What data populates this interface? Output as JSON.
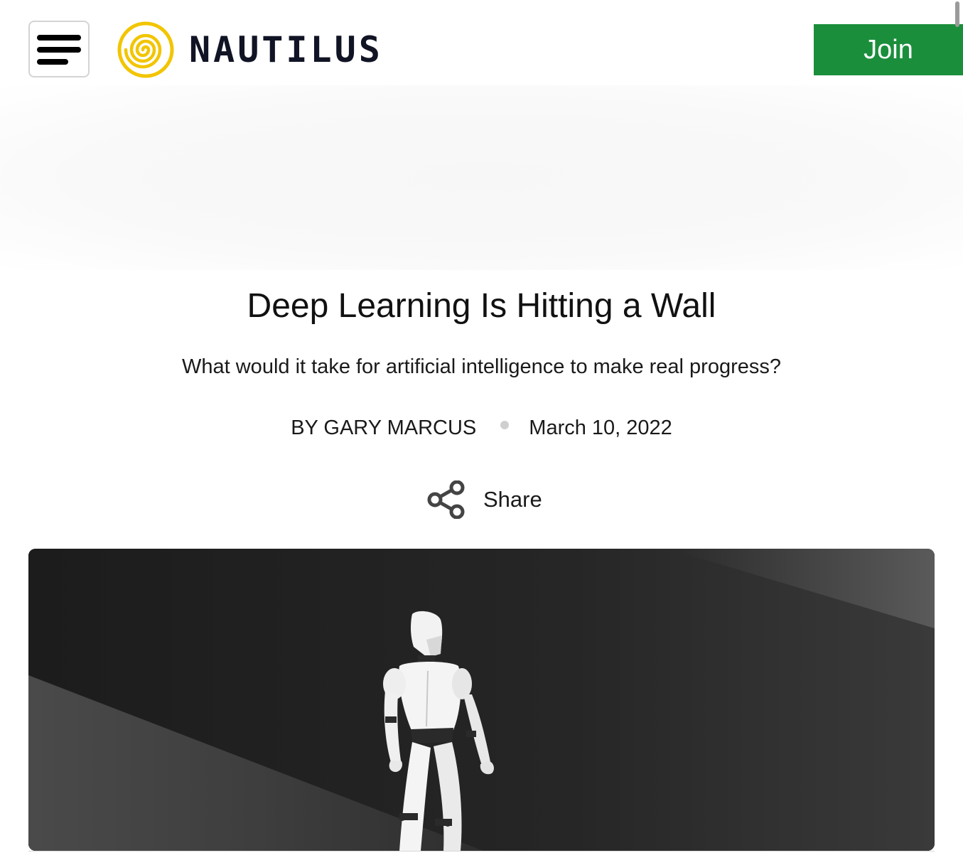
{
  "header": {
    "menu_label": "Menu",
    "logo_text": "NAUTILUS",
    "join_label": "Join"
  },
  "colors": {
    "brand_yellow": "#f2c500",
    "brand_navy": "#111424",
    "join_green": "#1b8e3c"
  },
  "article": {
    "title": "Deep Learning Is Hitting a Wall",
    "subtitle": "What would it take for artificial intelligence to make real progress?",
    "byline": "BY GARY MARCUS",
    "date": "March 10, 2022",
    "share_label": "Share"
  },
  "icons": {
    "menu": "hamburger-icon",
    "logo": "spiral-logo-icon",
    "share": "share-icon"
  }
}
